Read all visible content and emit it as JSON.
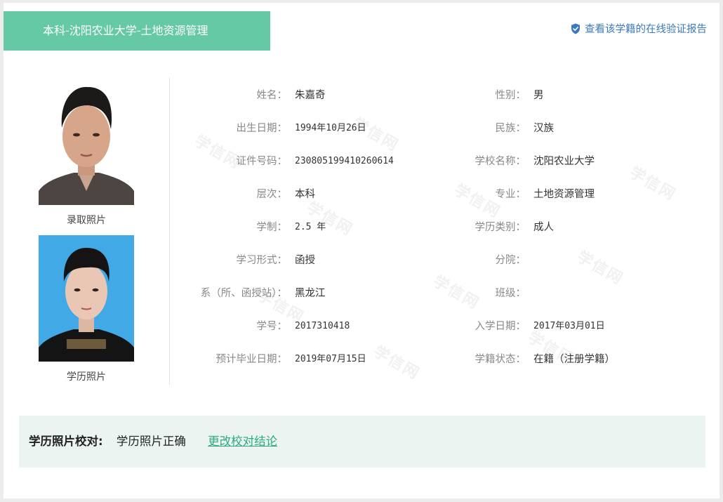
{
  "colors": {
    "banner": "#64c9a4",
    "link": "#3b78bf",
    "verify_link": "#2dab7d",
    "verify_bg": "#ebf4f1"
  },
  "header": {
    "title": "本科-沈阳农业大学-土地资源管理",
    "verify_link": "查看该学籍的在线验证报告",
    "verify_icon": "shield-check-icon"
  },
  "watermark": "学信网",
  "photos": {
    "admission_caption": "录取照片",
    "education_caption": "学历照片"
  },
  "fields": {
    "name_label": "姓名：",
    "name": "朱嘉奇",
    "gender_label": "性别：",
    "gender": "男",
    "birth_label": "出生日期：",
    "birth": "1994年10月26日",
    "ethnicity_label": "民族：",
    "ethnicity": "汉族",
    "id_label": "证件号码：",
    "id": "230805199410260614",
    "school_label": "学校名称：",
    "school": "沈阳农业大学",
    "level_label": "层次：",
    "level": "本科",
    "major_label": "专业：",
    "major": "土地资源管理",
    "duration_label": "学制：",
    "duration": "2.5 年",
    "category_label": "学历类别：",
    "category": "成人",
    "form_label": "学习形式：",
    "form": "函授",
    "branch_label": "分院：",
    "branch": "",
    "dept_label": "系（所、函授站）：",
    "dept": "黑龙江",
    "class_label": "班级：",
    "class": "",
    "student_no_label": "学号：",
    "student_no": "2017310418",
    "enroll_label": "入学日期：",
    "enroll": "2017年03月01日",
    "grad_label": "预计毕业日期：",
    "grad": "2019年07月15日",
    "status_label": "学籍状态：",
    "status": "在籍（注册学籍）"
  },
  "photo_check": {
    "label": "学历照片校对:",
    "result": "学历照片正确",
    "change_link": "更改校对结论"
  }
}
